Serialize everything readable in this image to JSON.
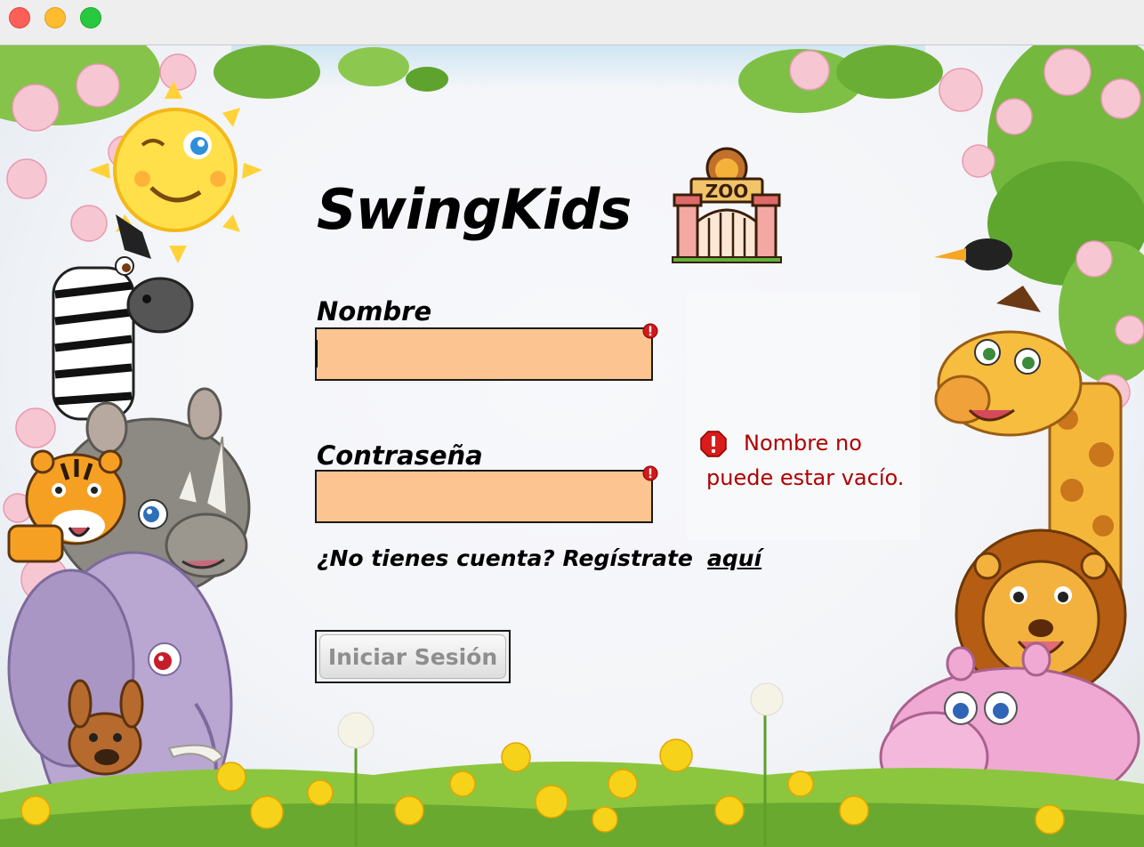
{
  "window": {
    "controls": [
      "close",
      "minimize",
      "zoom"
    ]
  },
  "app": {
    "title": "SwingKids",
    "logo_icon": "zoo-gate-icon",
    "logo_text": "ZOO"
  },
  "form": {
    "name_label": "Nombre",
    "name_value": "",
    "password_label": "Contraseña",
    "password_value": "",
    "field_error_color": "#fcc490",
    "signup_prompt": "¿No tienes cuenta? Regístrate",
    "signup_link": "aquí",
    "login_button": "Iniciar Sesión"
  },
  "error": {
    "icon": "error-icon",
    "message": "Nombre no puede estar vacío.",
    "color": "#b00000"
  },
  "decor": {
    "characters": [
      "sun",
      "zebra",
      "rhino",
      "tiger",
      "elephant",
      "kangaroo",
      "giraffe",
      "lion",
      "hippo",
      "toucan"
    ],
    "plants": [
      "cherry-blossoms",
      "leaves",
      "dandelions"
    ]
  }
}
